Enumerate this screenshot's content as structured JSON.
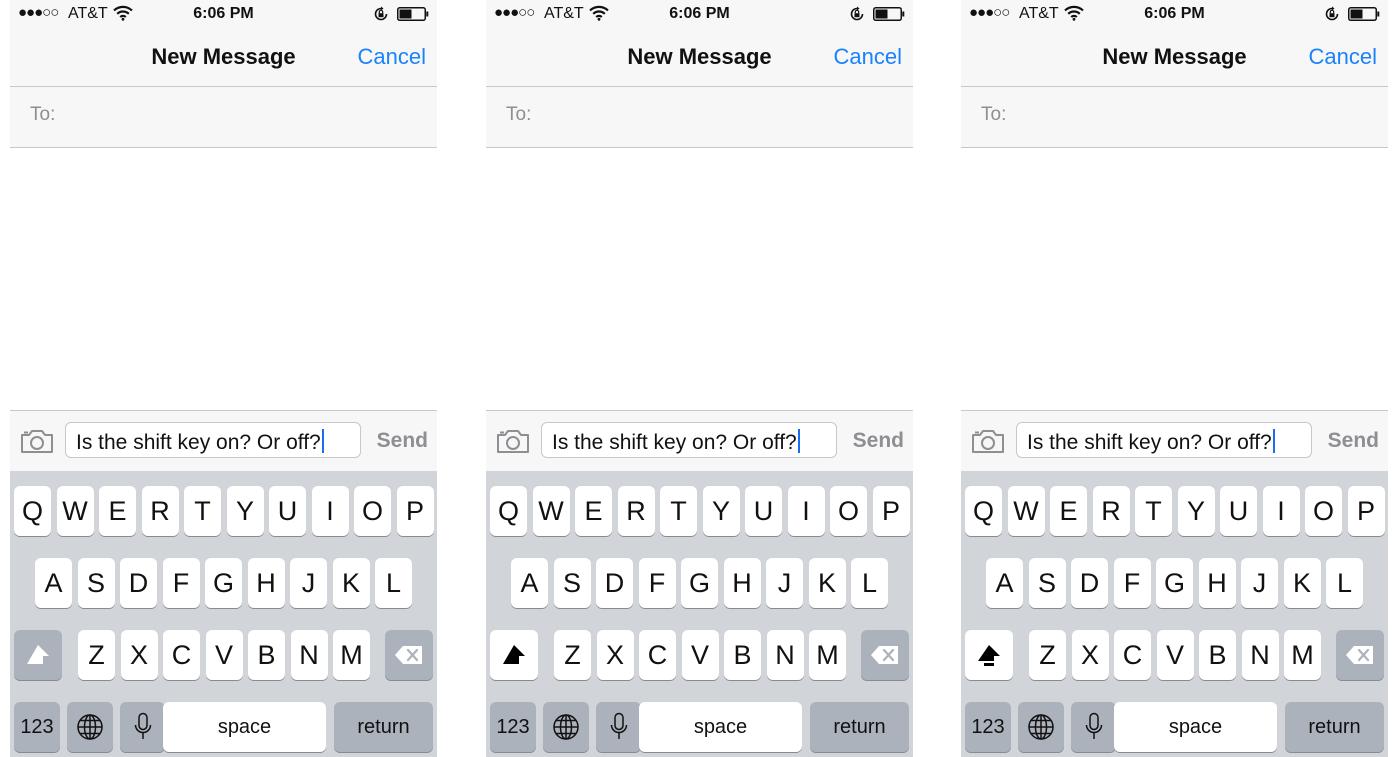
{
  "status_bar": {
    "signal": "●●●○○",
    "carrier": "AT&T",
    "time": "6:06 PM"
  },
  "nav": {
    "title": "New Message",
    "cancel_label": "Cancel"
  },
  "recipient": {
    "label": "To:"
  },
  "compose": {
    "message_text": "Is the shift key on? Or off?",
    "send_label": "Send"
  },
  "keyboard": {
    "row1": [
      "Q",
      "W",
      "E",
      "R",
      "T",
      "Y",
      "U",
      "I",
      "O",
      "P"
    ],
    "row2": [
      "A",
      "S",
      "D",
      "F",
      "G",
      "H",
      "J",
      "K",
      "L"
    ],
    "row3": [
      "Z",
      "X",
      "C",
      "V",
      "B",
      "N",
      "M"
    ],
    "numbers_label": "123",
    "space_label": "space",
    "return_label": "return"
  },
  "panels": [
    {
      "shift_state": "off",
      "shift_key_color": "#abb2bb",
      "shift_arrow_color": "#ffffff"
    },
    {
      "shift_state": "on",
      "shift_key_color": "#ffffff",
      "shift_arrow_color": "#000000"
    },
    {
      "shift_state": "caps-lock",
      "shift_key_color": "#ffffff",
      "shift_arrow_color": "#000000"
    }
  ],
  "colors": {
    "accent": "#1a82fb",
    "caret": "#1a6cf5",
    "keyboard_bg": "#d1d4d9",
    "function_key": "#abb2bb"
  },
  "icons": [
    "wifi-icon",
    "rotation-lock-icon",
    "battery-icon",
    "camera-icon",
    "shift-icon",
    "delete-icon",
    "globe-icon",
    "microphone-icon"
  ]
}
